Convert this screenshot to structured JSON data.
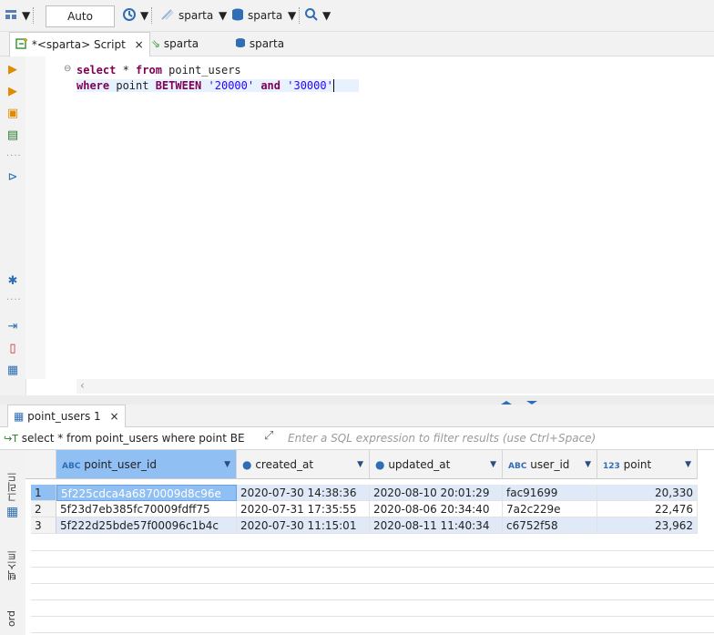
{
  "toolbar": {
    "mode_value": "Auto",
    "datasource": "sparta",
    "schema": "sparta"
  },
  "editor_tabs": [
    {
      "label": "*<sparta> Script"
    },
    {
      "label": "sparta"
    },
    {
      "label": "sparta"
    }
  ],
  "editor": {
    "line1": {
      "kw1": "select",
      "rest1": " * ",
      "kw2": "from",
      "rest2": " point_users"
    },
    "line2": {
      "kw1": "where",
      "rest1": " point ",
      "kw2": "BETWEEN",
      "str1": "'20000'",
      "kw3": "and",
      "str2": "'30000'"
    }
  },
  "results": {
    "tab_label": "point_users 1",
    "filter_query": "select * from point_users where point BE",
    "filter_placeholder": "Enter a SQL expression to filter results (use Ctrl+Space)",
    "side_tabs": [
      "그리드",
      "텍스트",
      "ord"
    ],
    "columns": [
      {
        "type_badge": "ABC",
        "name": "point_user_id"
      },
      {
        "type_badge": "clock",
        "name": "created_at"
      },
      {
        "type_badge": "clock",
        "name": "updated_at"
      },
      {
        "type_badge": "ABC",
        "name": "user_id"
      },
      {
        "type_badge": "123",
        "name": "point"
      }
    ],
    "rows": [
      {
        "n": "1",
        "point_user_id": "5f225cdca4a6870009d8c96e",
        "created_at": "2020-07-30 14:38:36",
        "updated_at": "2020-08-10 20:01:29",
        "user_id": "fac91699",
        "point": "20,330"
      },
      {
        "n": "2",
        "point_user_id": "5f23d7eb385fc70009fdff75",
        "created_at": "2020-07-31 17:35:55",
        "updated_at": "2020-08-06 20:34:40",
        "user_id": "7a2c229e",
        "point": "22,476"
      },
      {
        "n": "3",
        "point_user_id": "5f222d25bde57f00096c1b4c",
        "created_at": "2020-07-30 11:15:01",
        "updated_at": "2020-08-11 11:40:34",
        "user_id": "c6752f58",
        "point": "23,962"
      }
    ]
  },
  "colors": {
    "keyword": "#7f0055",
    "string": "#2a00ff",
    "selected_header": "#8fbff3",
    "row_highlight": "#dfe9f7"
  }
}
